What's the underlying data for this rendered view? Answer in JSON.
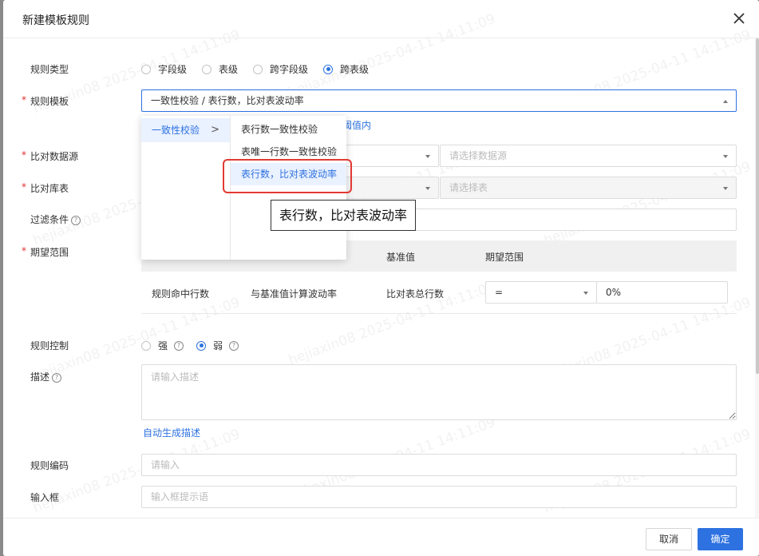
{
  "dialog": {
    "title": "新建模板规则",
    "close_icon": "close-icon"
  },
  "rule_type": {
    "label": "规则类型",
    "options": [
      "字段级",
      "表级",
      "跨字段级",
      "跨表级"
    ],
    "selected": "跨表级"
  },
  "rule_template": {
    "required_mark": "*",
    "label": "规则模板",
    "value": "一致性校验 / 表行数，比对表波动率",
    "hint_link": "阈值内"
  },
  "compare_source": {
    "required_mark": "*",
    "label": "比对数据源",
    "placeholder": "请选择数据源"
  },
  "compare_table": {
    "required_mark": "*",
    "label": "比对库表",
    "placeholder": "请选择表"
  },
  "filter": {
    "label": "过滤条件"
  },
  "expect_range": {
    "required_mark": "*",
    "label": "期望范围",
    "headers": [
      "基准值",
      "期望范围"
    ],
    "row": {
      "metric": "规则命中行数",
      "calc": "与基准值计算波动率",
      "baseline": "比对表总行数",
      "operator": "=",
      "value": "0%"
    }
  },
  "rule_control": {
    "label": "规则控制",
    "options": [
      "强",
      "弱"
    ],
    "selected": "弱"
  },
  "description": {
    "label": "描述",
    "placeholder": "请输入描述",
    "auto_link": "自动生成描述"
  },
  "rule_code": {
    "label": "规则编码",
    "placeholder": "请输入"
  },
  "input_box": {
    "label": "输入框",
    "placeholder": "输入框提示语"
  },
  "dropdown": {
    "category": "一致性校验",
    "items": [
      "表行数一致性校验",
      "表唯一行数一致性校验",
      "表行数，比对表波动率"
    ],
    "selected_index": 2
  },
  "tooltip": "表行数，比对表波动率",
  "footer": {
    "cancel": "取消",
    "ok": "确定"
  },
  "watermark": "hejiaxin08 2025-04-11 14:11:09",
  "colors": {
    "primary": "#2d72e0",
    "required": "#e0302b",
    "highlight_box": "#e23a33"
  }
}
